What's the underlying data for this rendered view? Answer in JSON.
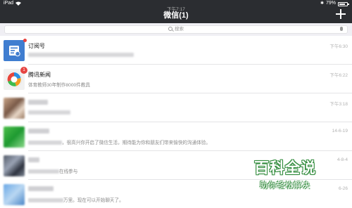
{
  "status_bar": {
    "carrier": "iPad",
    "time": "下午7:17",
    "battery": "79%",
    "battery_level": 0.79
  },
  "nav": {
    "title": "微信(1)",
    "add_icon": "plus-icon"
  },
  "search": {
    "placeholder": "搜索",
    "search_icon": "search-icon",
    "mic_icon": "microphone-icon"
  },
  "chats": [
    {
      "name": "订阅号",
      "message": "",
      "time": "下午6:30",
      "badge": "",
      "has_dot": true,
      "avatar": "subscription-icon"
    },
    {
      "name": "腾讯新闻",
      "message": "体育教师30年制作8000件教具",
      "time": "下午6:22",
      "badge": "1",
      "has_dot": false,
      "avatar": "tencent-news-icon"
    },
    {
      "name": "",
      "message": "",
      "time": "下午3:18",
      "badge": "",
      "has_dot": false,
      "avatar": "contact-avatar"
    },
    {
      "name": "",
      "message": "，很高兴你开启了微信生活，期待能为你和朋友们带来愉快的沟通体验。",
      "time": "14-6-19",
      "badge": "",
      "has_dot": false,
      "avatar": "contact-avatar"
    },
    {
      "name": "",
      "message": "在线参与",
      "time": "4-8-4",
      "badge": "",
      "has_dot": false,
      "avatar": "contact-avatar"
    },
    {
      "name": "",
      "message": "万里。现在可以开始聊天了。",
      "time": "6-26",
      "badge": "",
      "has_dot": false,
      "avatar": "contact-avatar"
    }
  ],
  "watermark": {
    "title": "百科全说",
    "subtitle": "助你轻松解决"
  }
}
